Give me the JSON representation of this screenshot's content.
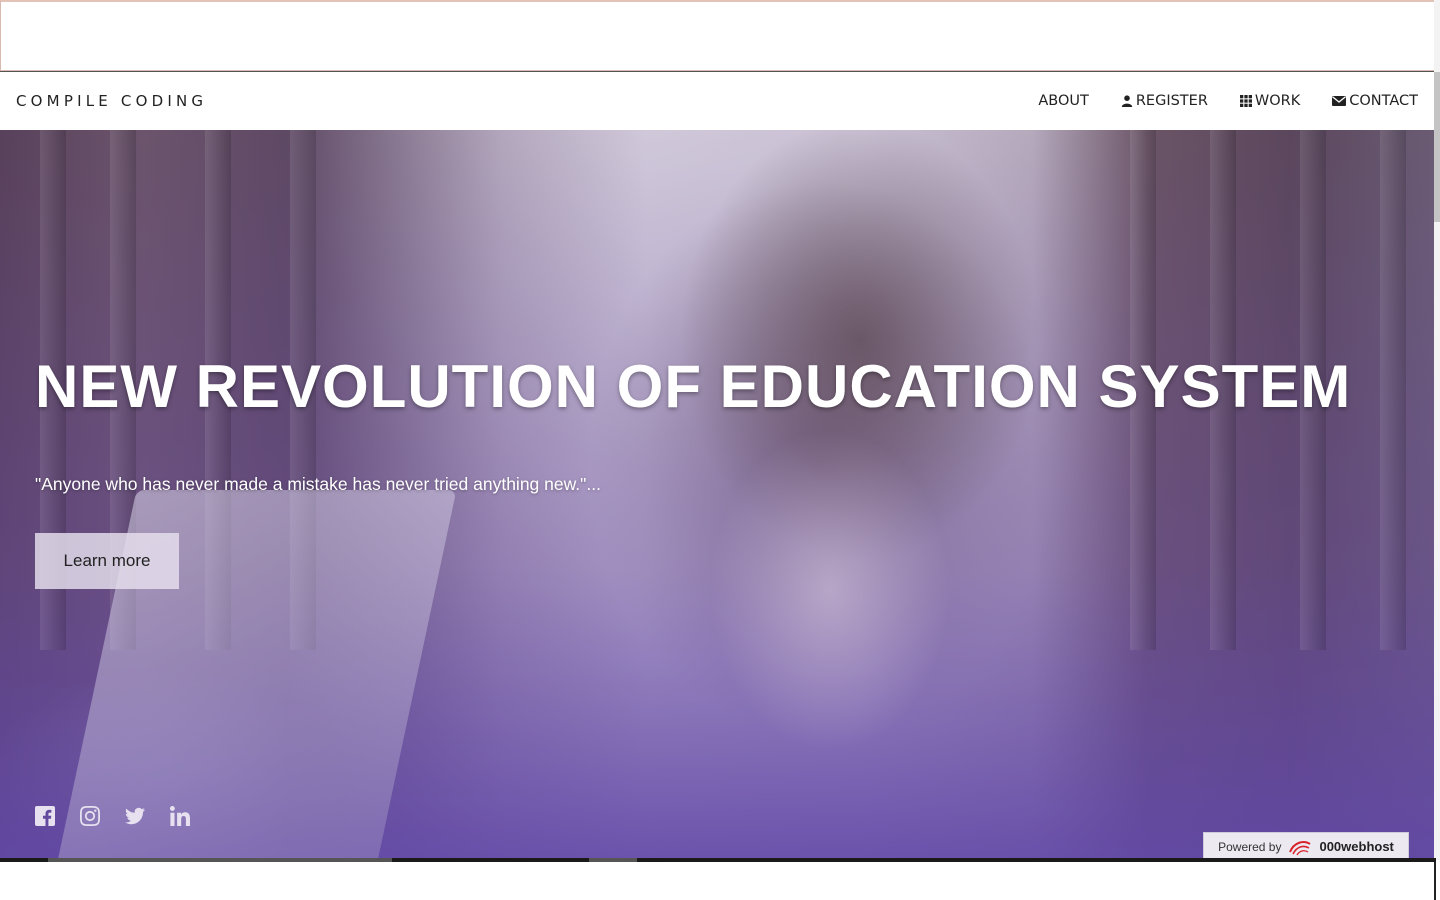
{
  "brand": "COMPILE CODING",
  "nav": {
    "about": "ABOUT",
    "register": "REGISTER",
    "work": "WORK",
    "contact": "CONTACT"
  },
  "hero": {
    "title": "NEW REVOLUTION OF EDUCATION SYSTEM",
    "quote": "\"Anyone who has never made a mistake has never tried anything new.\"...",
    "cta_label": "Learn more"
  },
  "socials": [
    "facebook-icon",
    "instagram-icon",
    "twitter-icon",
    "linkedin-icon"
  ],
  "powered_by": {
    "label": "Powered by",
    "brand": "000webhost"
  },
  "colors": {
    "hero_overlay": "#6248a8",
    "cta_bg": "#e6e1ee",
    "nav_text": "#222222"
  }
}
